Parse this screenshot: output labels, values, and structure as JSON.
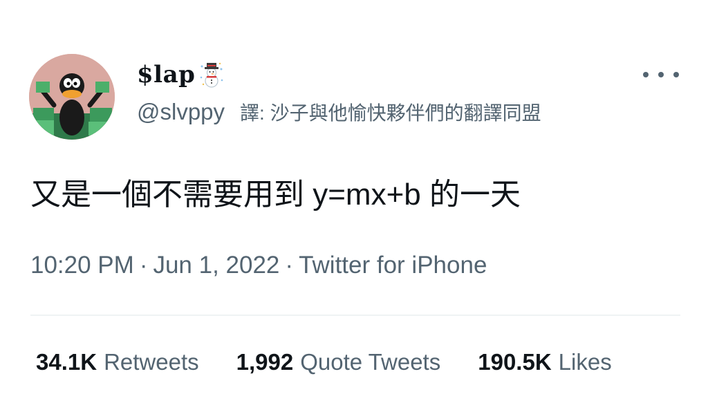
{
  "author": {
    "display_name": "$lap",
    "display_name_emoji": "snowman-icon",
    "handle": "@slvppy",
    "avatar_icon": "daffy-duck-avatar",
    "translator_note": "譯: 沙子與他愉快夥伴們的翻譯同盟"
  },
  "tweet": {
    "text": "又是一個不需要用到 y=mx+b 的一天"
  },
  "meta": {
    "time": "10:20 PM",
    "separator": "·",
    "date": "Jun 1, 2022",
    "source": "Twitter for iPhone"
  },
  "stats": {
    "retweets_count": "34.1K",
    "retweets_label": "Retweets",
    "quotes_count": "1,992",
    "quotes_label": "Quote Tweets",
    "likes_count": "190.5K",
    "likes_label": "Likes"
  },
  "more_button_icon": "more-options-icon",
  "colors": {
    "text_primary": "#0f1419",
    "text_secondary": "#536471",
    "divider": "#eff3f4",
    "background": "#ffffff"
  }
}
